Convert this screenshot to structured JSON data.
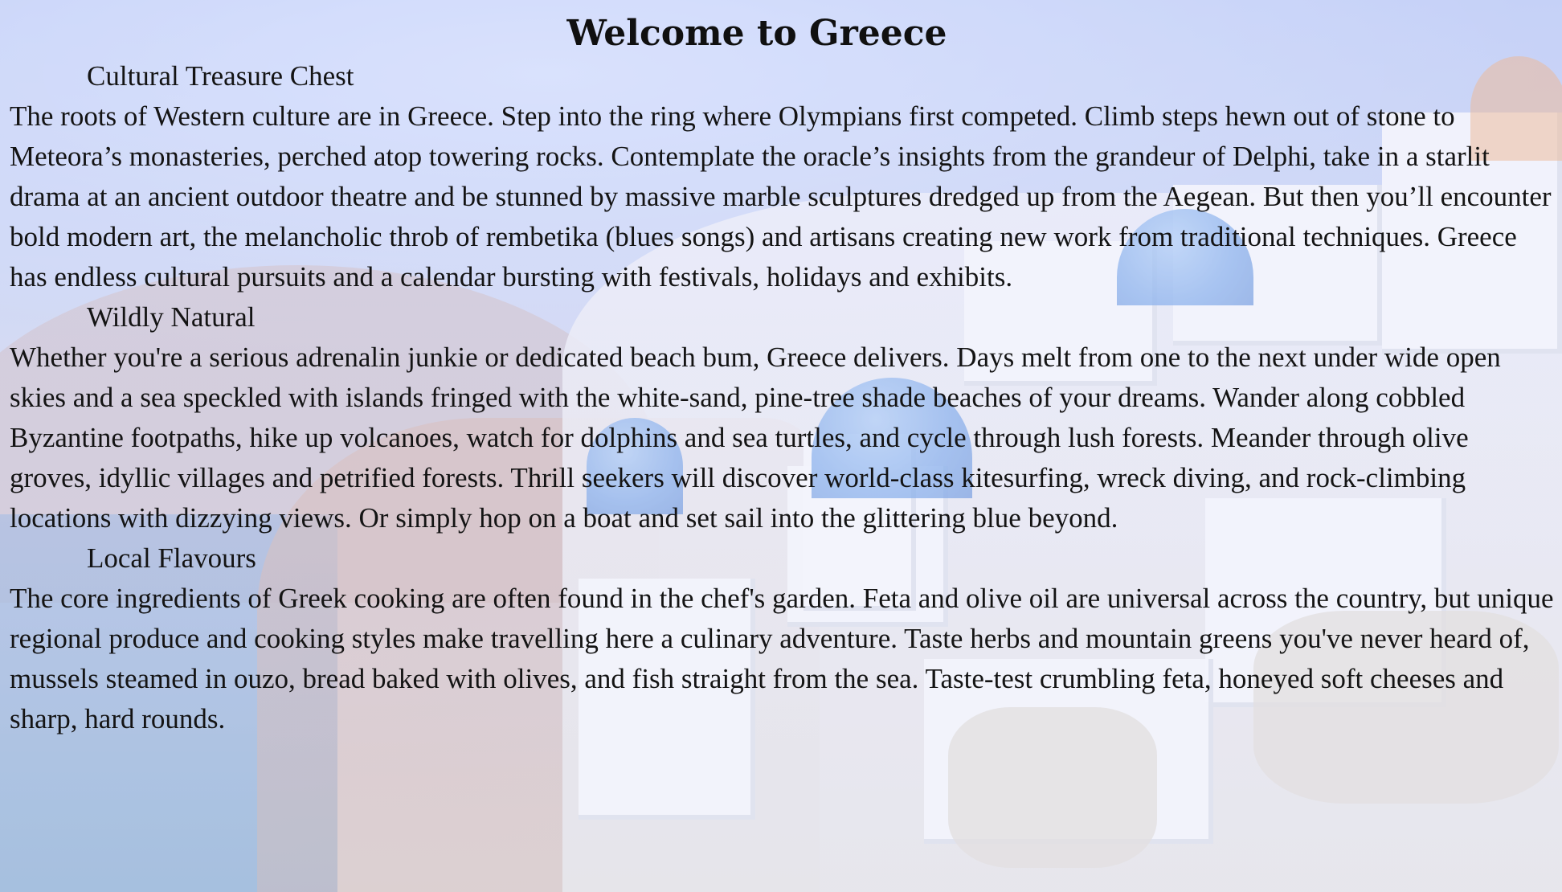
{
  "page": {
    "title": "Welcome to Greece"
  },
  "sections": [
    {
      "heading": "Cultural Treasure Chest",
      "body": "The roots of Western culture are in Greece. Step into the ring where Olympians first competed. Climb steps hewn out of stone to Meteora’s monasteries, perched atop towering rocks. Contemplate the oracle’s insights from the grandeur of Delphi, take in a starlit drama at an ancient outdoor theatre and be stunned by massive marble sculptures dredged up from the Aegean. But then you’ll encounter bold modern art, the melancholic throb of rembetika (blues songs) and artisans creating new work from traditional techniques. Greece has endless cultural pursuits and a calendar bursting with festivals, holidays and exhibits."
    },
    {
      "heading": "Wildly Natural",
      "body": "Whether you're a serious adrenalin junkie or dedicated beach bum, Greece delivers. Days melt from one to the next under wide open skies and a sea speckled with islands fringed with the white-sand, pine-tree shade beaches of your dreams. Wander along cobbled Byzantine footpaths, hike up volcanoes, watch for dolphins and sea turtles, and cycle through lush forests. Meander through olive groves, idyllic villages and petrified forests. Thrill seekers will discover world-class kitesurfing, wreck diving, and rock-climbing locations with dizzying views. Or simply hop on a boat and set sail into the glittering blue beyond."
    },
    {
      "heading": "Local Flavours",
      "body": "The core ingredients of Greek cooking are often found in the chef's garden. Feta and olive oil are universal across the country, but unique regional produce and cooking styles make travelling here a culinary adventure. Taste herbs and mountain greens you've never heard of, mussels steamed in ouzo, bread baked with olives, and fish straight from the sea. Taste-test crumbling feta, honeyed soft cheeses and sharp, hard rounds."
    }
  ],
  "colors": {
    "text": "#141414",
    "sky": "#b9c8f6",
    "dome_blue": "#6d9fe8"
  }
}
